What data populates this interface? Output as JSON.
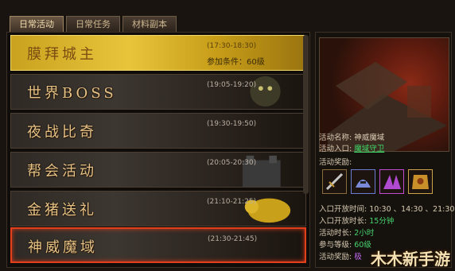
{
  "tabs": [
    {
      "label": "日常活动",
      "active": true
    },
    {
      "label": "日常任务",
      "active": false
    },
    {
      "label": "材料副本",
      "active": false
    }
  ],
  "activities": [
    {
      "name": "膜拜城主",
      "time": "(17:30-18:30)",
      "condition": "参加条件：60级",
      "style": "gold"
    },
    {
      "name": "世界BOSS",
      "time": "(19:05-19:20)",
      "condition": "",
      "style": "normal"
    },
    {
      "name": "夜战比奇",
      "time": "(19:30-19:50)",
      "condition": "",
      "style": "normal"
    },
    {
      "name": "帮会活动",
      "time": "(20:05-20:30)",
      "condition": "",
      "style": "normal"
    },
    {
      "name": "金猪送礼",
      "time": "(21:10-21:25)",
      "condition": "",
      "style": "normal"
    },
    {
      "name": "神威魔域",
      "time": "(21:30-21:45)",
      "condition": "",
      "style": "selected"
    }
  ],
  "details": {
    "name_label": "活动名称:",
    "name_value": "神威魔域",
    "entry_label": "活动入口:",
    "entry_value": "魔域守卫",
    "reward_label": "活动奖励:",
    "open_time_label": "入口开放时间:",
    "open_time_value": "10:30 、14:30 、21:30",
    "open_duration_label": "入口开放时长:",
    "open_duration_value": "15分钟",
    "duration_label": "活动时长:",
    "duration_value": "2小时",
    "level_label": "参与等级:",
    "level_value": "60级",
    "reward2_label": "活动奖励:",
    "reward2_value": "极"
  },
  "reward_items": [
    {
      "icon": "sword-icon",
      "color": "#8a6b3a"
    },
    {
      "icon": "helmet-icon",
      "color": "#6a7bd0"
    },
    {
      "icon": "claw-icon",
      "color": "#c04ad0"
    },
    {
      "icon": "armor-icon",
      "color": "#c9a24a"
    }
  ],
  "watermark": "木木新手游"
}
